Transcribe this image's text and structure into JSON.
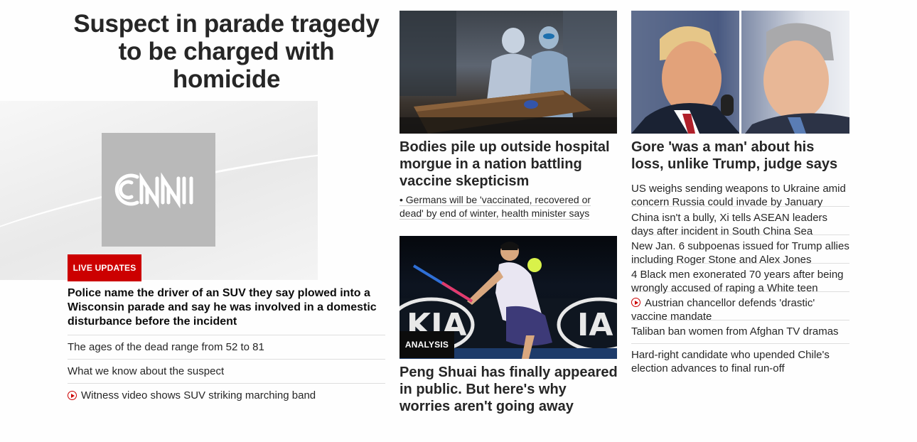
{
  "hero": {
    "title": "Suspect in parade tragedy to be charged with homicide",
    "logo_text": "CNN",
    "badge": "LIVE UPDATES",
    "lead": "Police name the driver of an SUV they say plowed into a Wisconsin parade and say he was involved in a domestic disturbance before the incident",
    "bullets": [
      {
        "text": "The ages of the dead range from 52 to 81",
        "video": false
      },
      {
        "text": "What we know about the suspect",
        "video": false
      },
      {
        "text": "Witness video shows SUV striking marching band",
        "video": true
      }
    ]
  },
  "story_morgue": {
    "headline": "Bodies pile up outside hospital morgue in a nation battling vaccine skepticism",
    "sub": "• Germans will be 'vaccinated, recovered or dead' by end of winter, health minister says"
  },
  "story_tennis": {
    "badge": "ANALYSIS",
    "headline": "Peng Shuai has finally appeared in public. But here's why worries aren't going away",
    "sign_text": "KIA"
  },
  "story_gore": {
    "headline": "Gore 'was a man' about his loss, unlike Trump, judge says",
    "items": [
      {
        "text": "US weighs sending weapons to Ukraine amid concern Russia could invade by January",
        "video": false
      },
      {
        "text": "China isn't a bully, Xi tells ASEAN leaders days after incident in South China Sea",
        "video": false
      },
      {
        "text": "New Jan. 6 subpoenas issued for Trump allies including Roger Stone and Alex Jones",
        "video": false
      },
      {
        "text": "4 Black men exonerated 70 years after being wrongly accused of raping a White teen",
        "video": false
      },
      {
        "text": "Austrian chancellor defends 'drastic' vaccine mandate",
        "video": true
      },
      {
        "text": "Taliban ban women from Afghan TV dramas",
        "video": false
      },
      {
        "text": "Hard-right candidate who upended Chile's election advances to final run-off",
        "video": false
      }
    ]
  },
  "colors": {
    "accent_red": "#cc0000",
    "text": "#0c0c0c",
    "divider": "#dedede"
  }
}
